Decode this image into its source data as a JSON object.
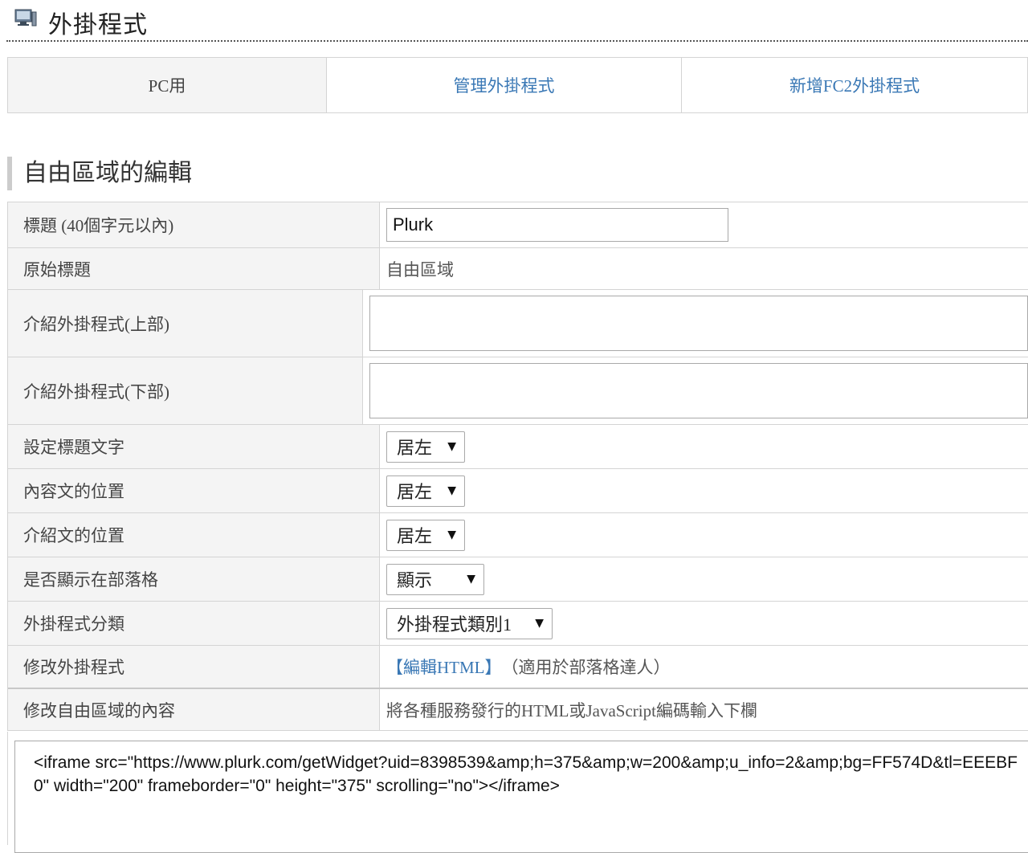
{
  "header": {
    "icon": "computer-monitor-icon",
    "title": "外掛程式"
  },
  "tabs": [
    {
      "label": "PC用",
      "active": true
    },
    {
      "label": "管理外掛程式",
      "active": false
    },
    {
      "label": "新增FC2外掛程式",
      "active": false
    }
  ],
  "section": {
    "title": "自由區域的編輯"
  },
  "form": {
    "title_label": "標題 (40個字元以內)",
    "title_value": "Plurk",
    "original_title_label": "原始標題",
    "original_title_value": "自由區域",
    "intro_top_label": "介紹外掛程式(上部)",
    "intro_bottom_label": "介紹外掛程式(下部)",
    "title_align_label": "設定標題文字",
    "title_align_value": "居左",
    "content_align_label": "內容文的位置",
    "content_align_value": "居左",
    "intro_align_label": "介紹文的位置",
    "intro_align_value": "居左",
    "display_label": "是否顯示在部落格",
    "display_value": "顯示",
    "category_label": "外掛程式分類",
    "category_value": "外掛程式類別1",
    "edit_plugin_label": "修改外掛程式",
    "edit_html_link": "【編輯HTML】",
    "edit_html_note": "（適用於部落格達人）",
    "edit_content_label": "修改自由區域的內容",
    "edit_content_hint": "將各種服務發行的HTML或JavaScript編碼輸入下欄"
  },
  "code": {
    "value": "<iframe src=\"https://www.plurk.com/getWidget?uid=8398539&amp;h=375&amp;w=200&amp;u_info=2&amp;bg=FF574D&tl=EEEBF0\" width=\"200\" frameborder=\"0\" height=\"375\" scrolling=\"no\"></iframe>"
  },
  "colors": {
    "link": "#3a78b5",
    "label_bg": "#f4f4f4",
    "border": "#d4d4d4"
  }
}
